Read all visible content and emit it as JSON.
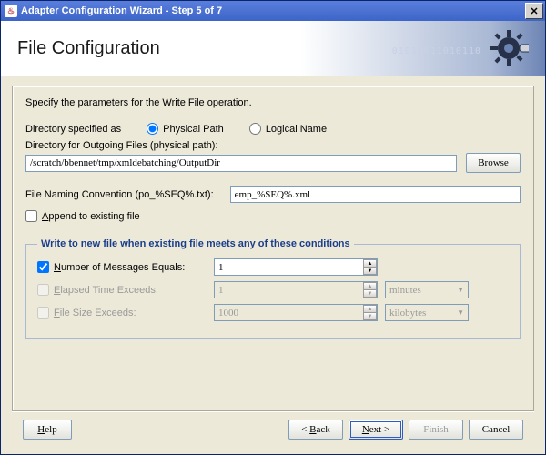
{
  "window": {
    "title": "Adapter Configuration Wizard - Step 5 of 7"
  },
  "header": {
    "title": "File Configuration"
  },
  "intro": "Specify the parameters for the Write File operation.",
  "dirSpec": {
    "label_pre": "Directory specified as",
    "physical": "Physical Path",
    "logical": "Logical Name"
  },
  "outDir": {
    "label": "Directory for Outgoing Files (physical path):",
    "value": "/scratch/bbennet/tmp/xmldebatching/OutputDir",
    "browse": "Browse"
  },
  "naming": {
    "label": "File Naming Convention (po_%SEQ%.txt):",
    "value": "emp_%SEQ%.xml"
  },
  "append": {
    "label": "Append to existing file"
  },
  "conditions": {
    "legend": "Write to new file when existing file meets any of these conditions",
    "msgCount": {
      "label": "Number of Messages Equals:",
      "value": "1"
    },
    "elapsed": {
      "label": "Elapsed Time Exceeds:",
      "value": "1",
      "unit": "minutes"
    },
    "fileSize": {
      "label": "File Size Exceeds:",
      "value": "1000",
      "unit": "kilobytes"
    }
  },
  "footer": {
    "help": "Help",
    "back": "< Back",
    "next": "Next >",
    "finish": "Finish",
    "cancel": "Cancel"
  },
  "underlines": {
    "browse": "r",
    "append": "A",
    "number": "N",
    "elapsed": "E",
    "filesize": "F",
    "help": "H",
    "back": "B",
    "next": "N"
  }
}
